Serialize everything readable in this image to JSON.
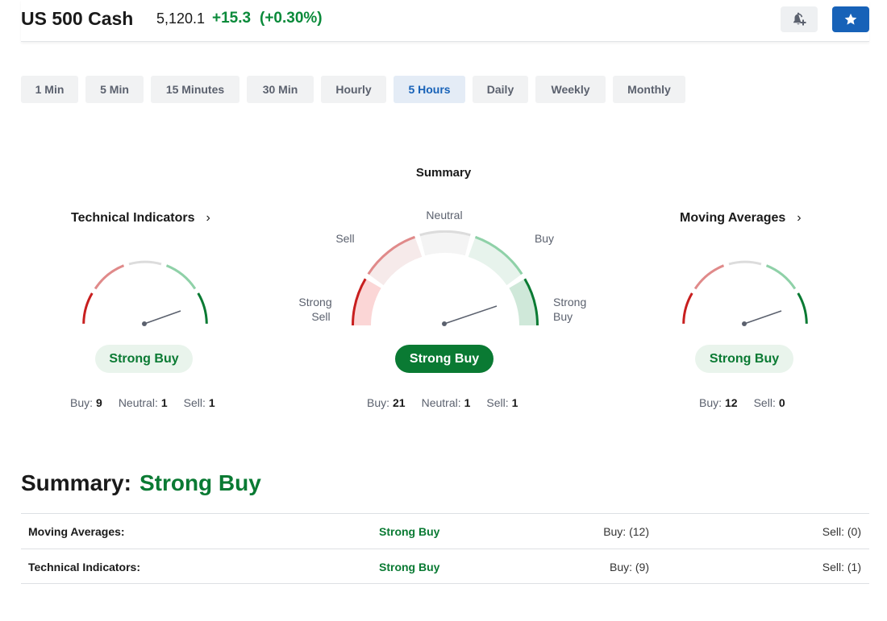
{
  "header": {
    "title": "US 500 Cash",
    "price": "5,120.1",
    "change": "+15.3",
    "change_pct": "(+0.30%)",
    "alert_icon": "bell-plus-icon",
    "watchlist_icon": "star-icon"
  },
  "timeframes": {
    "items": [
      "1 Min",
      "5 Min",
      "15 Minutes",
      "30 Min",
      "Hourly",
      "5 Hours",
      "Daily",
      "Weekly",
      "Monthly"
    ],
    "active": "5 Hours"
  },
  "gauges": {
    "summary_heading": "Summary",
    "technical": {
      "title": "Technical Indicators",
      "signal": "Strong Buy",
      "buy_label": "Buy:",
      "buy": "9",
      "neutral_label": "Neutral:",
      "neutral": "1",
      "sell_label": "Sell:",
      "sell": "1"
    },
    "summary": {
      "labels": {
        "strong_sell_1": "Strong",
        "strong_sell_2": "Sell",
        "sell": "Sell",
        "neutral": "Neutral",
        "buy": "Buy",
        "strong_buy_1": "Strong",
        "strong_buy_2": "Buy"
      },
      "signal": "Strong Buy",
      "buy_label": "Buy:",
      "buy": "21",
      "neutral_label": "Neutral:",
      "neutral": "1",
      "sell_label": "Sell:",
      "sell": "1"
    },
    "moving_averages": {
      "title": "Moving Averages",
      "signal": "Strong Buy",
      "buy_label": "Buy:",
      "buy": "12",
      "sell_label": "Sell:",
      "sell": "0"
    }
  },
  "summary_table": {
    "title_label": "Summary:",
    "title_value": "Strong Buy",
    "rows": [
      {
        "name": "Moving Averages:",
        "signal": "Strong Buy",
        "buy": "Buy: (12)",
        "sell": "Sell: (0)"
      },
      {
        "name": "Technical Indicators:",
        "signal": "Strong Buy",
        "buy": "Buy: (9)",
        "sell": "Sell: (1)"
      }
    ]
  },
  "colors": {
    "positive": "#0a8a3a",
    "accent": "#1762b8",
    "strong_sell": "#c81f1f",
    "sell": "#e08a8a",
    "neutral": "#dcdcdc",
    "buy": "#8fd1a8",
    "strong_buy": "#0a7a33"
  }
}
